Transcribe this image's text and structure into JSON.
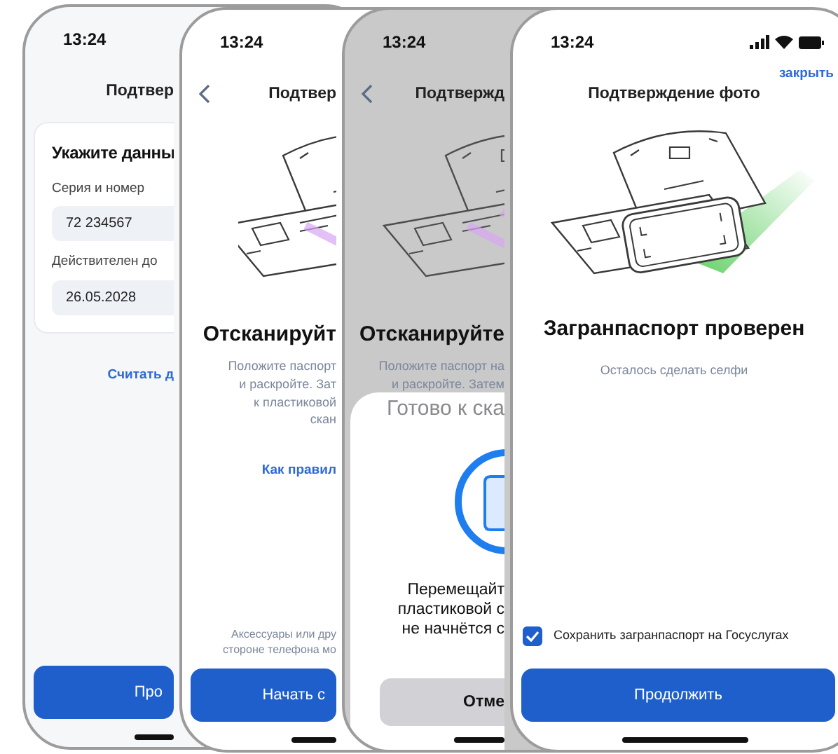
{
  "phones": [
    {
      "kind": "form",
      "time": "13:24",
      "title": "Подтвер",
      "card": {
        "heading": "Укажите данны",
        "fields": [
          {
            "label": "Серия и номер",
            "value": "72 234567"
          },
          {
            "label": "Действителен до",
            "value": "26.05.2028"
          }
        ]
      },
      "link": "Считать д",
      "button": "Про"
    },
    {
      "kind": "scan",
      "time": "13:24",
      "back": true,
      "title": "Подтвер",
      "heading": "Отсканируйт",
      "lines": [
        "Положите паспорт",
        "и раскройте. Зат",
        "к пластиковой",
        "скан"
      ],
      "link": "Как правил",
      "note_lines": [
        "Аксессуары или дру",
        "стороне телефона мо"
      ],
      "button": "Начать с"
    },
    {
      "kind": "scan",
      "dimmed": true,
      "time": "13:24",
      "back": true,
      "title": "Подтвержд",
      "heading": "Отсканируйте",
      "lines": [
        "Положите паспорт на",
        "и раскройте. Затем"
      ],
      "sheet": {
        "title": "Готово к ска",
        "lines": [
          "Перемещайт",
          "пластиковой с",
          "не начнётся с"
        ],
        "button": "Отме"
      }
    },
    {
      "kind": "done",
      "time": "13:24",
      "status_icons": true,
      "close_link": "закрыть",
      "title": "Подтверждение фото",
      "heading": "Загранпаспорт проверен",
      "subtitle": "Осталось сделать селфи",
      "checkbox": {
        "label": "Сохранить загранпаспорт на Госуслугах",
        "checked": true
      },
      "button": "Продолжить"
    }
  ]
}
